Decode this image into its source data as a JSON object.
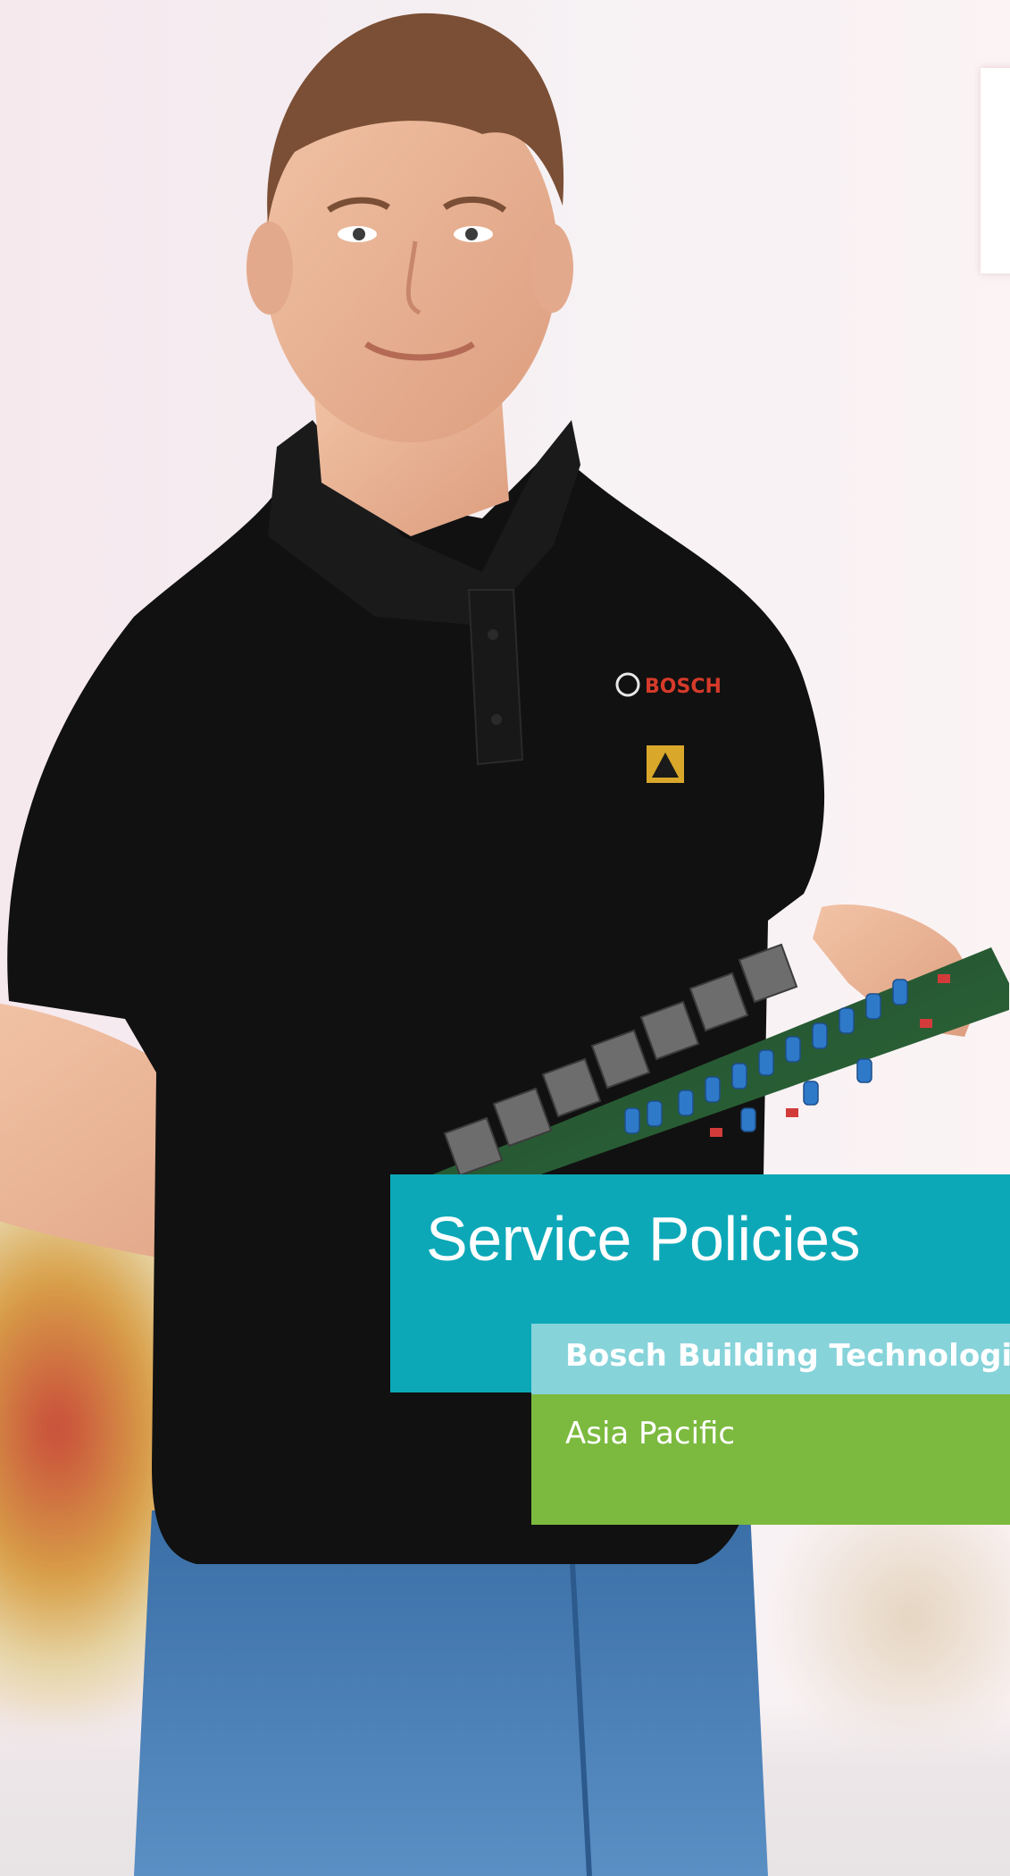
{
  "cover": {
    "title": "Service Policies",
    "company": "Bosch Building Technologies",
    "region": "Asia Pacific",
    "shirt_logo_text": "BOSCH",
    "colors": {
      "teal_panel": "#0ca8b8",
      "light_strip": "#86d3da",
      "green_panel": "#7cba3f",
      "shirt": "#111111",
      "jeans": "#3e74ad"
    }
  }
}
